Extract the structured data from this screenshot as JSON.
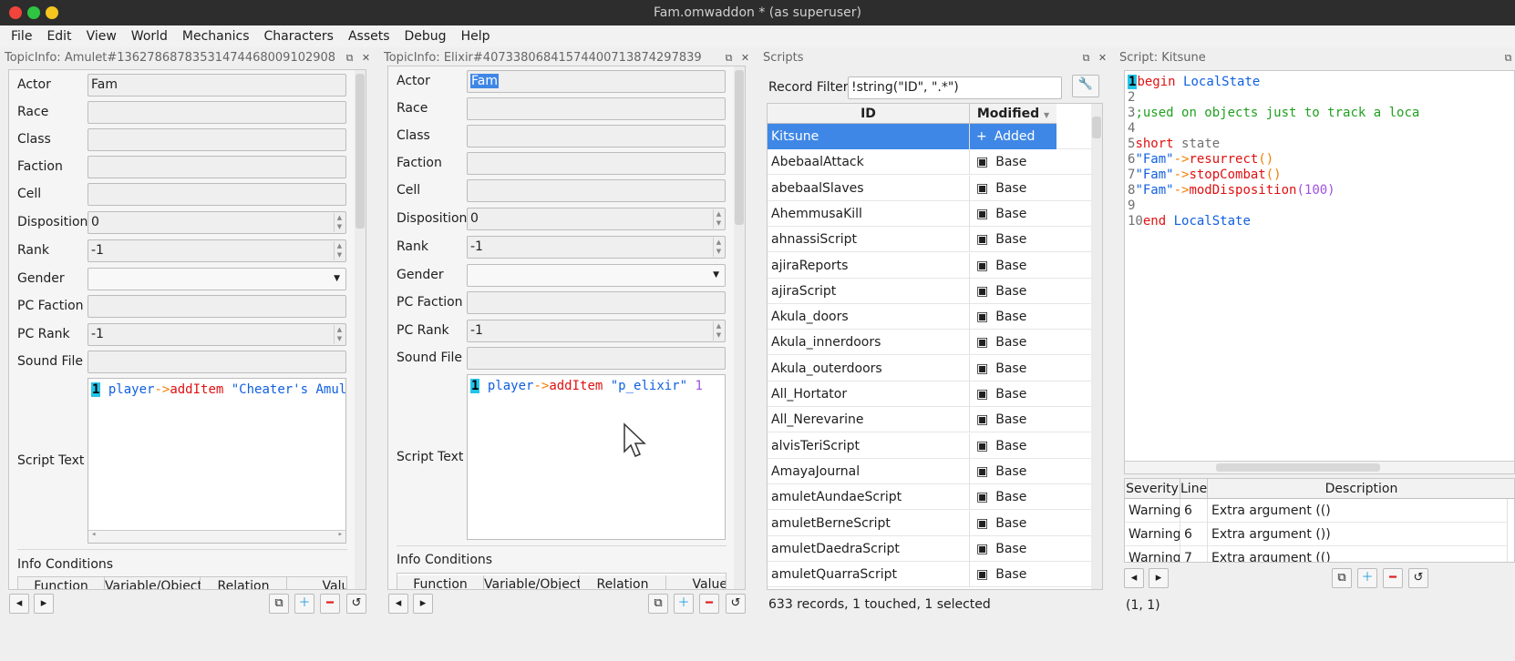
{
  "window": {
    "title": "Fam.omwaddon * (as superuser)"
  },
  "menu": [
    "File",
    "Edit",
    "View",
    "World",
    "Mechanics",
    "Characters",
    "Assets",
    "Debug",
    "Help"
  ],
  "topic1": {
    "title": "TopicInfo: Amulet#13627868783531474468009102908",
    "actor": "Fam",
    "disposition": "0",
    "rank": "-1",
    "pc_rank": "-1",
    "labels": {
      "actor": "Actor",
      "race": "Race",
      "class": "Class",
      "faction": "Faction",
      "cell": "Cell",
      "disposition": "Disposition",
      "rank": "Rank",
      "gender": "Gender",
      "pc_faction": "PC Faction",
      "pc_rank": "PC Rank",
      "sound_file": "Sound File",
      "script_text": "Script Text",
      "info_conditions": "Info Conditions"
    },
    "code": {
      "line": "1",
      "t1": "player",
      "t2": "->",
      "t3": "addItem",
      "t4": " \"Cheater's Amule"
    },
    "cond_headers": [
      "Function",
      "Variable/Object",
      "Relation",
      "Value"
    ]
  },
  "topic2": {
    "title": "TopicInfo: Elixir#40733806841574400713874297839",
    "actor": "Fam",
    "disposition": "0",
    "rank": "-1",
    "pc_rank": "-1",
    "labels": {
      "actor": "Actor",
      "race": "Race",
      "class": "Class",
      "faction": "Faction",
      "cell": "Cell",
      "disposition": "Disposition",
      "rank": "Rank",
      "gender": "Gender",
      "pc_faction": "PC Faction",
      "pc_rank": "PC Rank",
      "sound_file": "Sound File",
      "script_text": "Script Text",
      "info_conditions": "Info Conditions"
    },
    "code": {
      "line": "1",
      "t1": "player",
      "t2": "->",
      "t3": "addItem",
      "t4": " \"p_elixir\" ",
      "t5": "1"
    },
    "cond_headers": [
      "Function",
      "Variable/Object",
      "Relation",
      "Value"
    ]
  },
  "scripts": {
    "title": "Scripts",
    "filter_label": "Record Filter",
    "filter_value": "!string(\"ID\", \".*\")",
    "col_id": "ID",
    "col_modified": "Modified",
    "rows": [
      {
        "id": "Kitsune",
        "mod": "Added",
        "icon": "+"
      },
      {
        "id": "AbebaalAttack",
        "mod": "Base",
        "icon": "▣"
      },
      {
        "id": "abebaalSlaves",
        "mod": "Base",
        "icon": "▣"
      },
      {
        "id": "AhemmusaKill",
        "mod": "Base",
        "icon": "▣"
      },
      {
        "id": "ahnassiScript",
        "mod": "Base",
        "icon": "▣"
      },
      {
        "id": "ajiraReports",
        "mod": "Base",
        "icon": "▣"
      },
      {
        "id": "ajiraScript",
        "mod": "Base",
        "icon": "▣"
      },
      {
        "id": "Akula_doors",
        "mod": "Base",
        "icon": "▣"
      },
      {
        "id": "Akula_innerdoors",
        "mod": "Base",
        "icon": "▣"
      },
      {
        "id": "Akula_outerdoors",
        "mod": "Base",
        "icon": "▣"
      },
      {
        "id": "All_Hortator",
        "mod": "Base",
        "icon": "▣"
      },
      {
        "id": "All_Nerevarine",
        "mod": "Base",
        "icon": "▣"
      },
      {
        "id": "alvisTeriScript",
        "mod": "Base",
        "icon": "▣"
      },
      {
        "id": "AmayaJournal",
        "mod": "Base",
        "icon": "▣"
      },
      {
        "id": "amuletAundaeScript",
        "mod": "Base",
        "icon": "▣"
      },
      {
        "id": "amuletBerneScript",
        "mod": "Base",
        "icon": "▣"
      },
      {
        "id": "amuletDaedraScript",
        "mod": "Base",
        "icon": "▣"
      },
      {
        "id": "amuletQuarraScript",
        "mod": "Base",
        "icon": "▣"
      }
    ],
    "status": "633 records, 1 touched, 1 selected"
  },
  "script_editor": {
    "title": "Script: Kitsune",
    "status": "(1, 1)",
    "err_headers": [
      "Severity",
      "Line",
      "Description"
    ],
    "errors": [
      {
        "sev": "Warning",
        "line": "6",
        "desc": "Extra argument (()"
      },
      {
        "sev": "Warning",
        "line": "6",
        "desc": "Extra argument ())"
      },
      {
        "sev": "Warning",
        "line": "7",
        "desc": "Extra argument (()"
      }
    ]
  }
}
